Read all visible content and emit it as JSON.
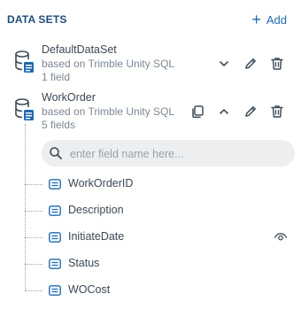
{
  "panel": {
    "title": "DATA SETS",
    "add_label": "Add"
  },
  "datasets": [
    {
      "name": "DefaultDataSet",
      "source": "based on Trimble Unity SQL",
      "count": "1 field",
      "expanded": false
    },
    {
      "name": "WorkOrder",
      "source": "based on Trimble Unity SQL",
      "count": "5 fields",
      "expanded": true
    }
  ],
  "search": {
    "placeholder": "enter field name here...",
    "value": ""
  },
  "fields": [
    {
      "label": "WorkOrderID"
    },
    {
      "label": "Description"
    },
    {
      "label": "InitiateDate",
      "icon": "eye-icon"
    },
    {
      "label": "Status"
    },
    {
      "label": "WOCost"
    }
  ],
  "colors": {
    "title": "#1f4e79",
    "accent": "#1f6ab1",
    "text": "#3a4754",
    "muted": "#7b8794"
  }
}
